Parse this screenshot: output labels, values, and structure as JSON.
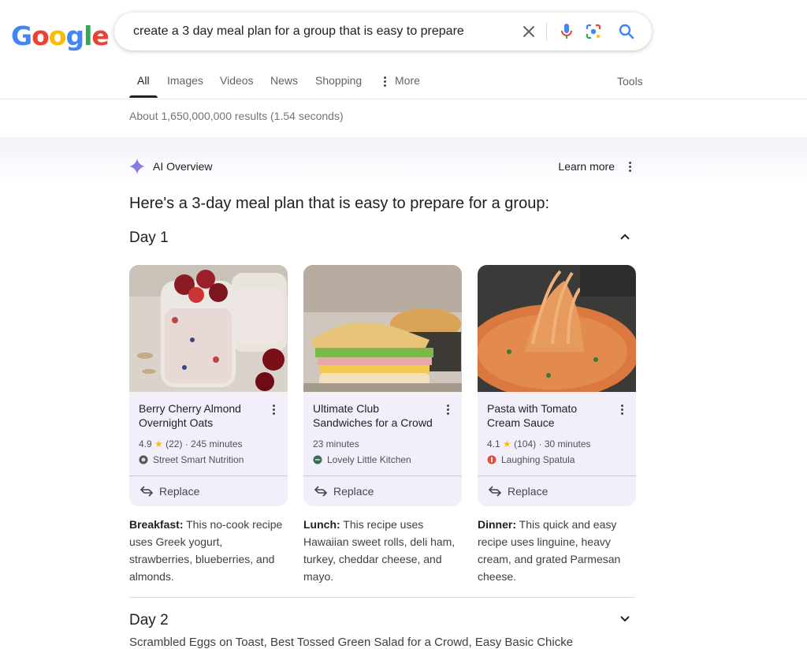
{
  "logo": {
    "letters": [
      "G",
      "o",
      "o",
      "g",
      "l",
      "e"
    ],
    "colors": [
      "#4285F4",
      "#EA4335",
      "#FBBC05",
      "#4285F4",
      "#34A853",
      "#EA4335"
    ]
  },
  "search": {
    "query": "create a 3 day meal plan for a group that is easy to prepare"
  },
  "tabs": {
    "items": [
      "All",
      "Images",
      "Videos",
      "News",
      "Shopping",
      "More"
    ],
    "tools": "Tools",
    "active": "All"
  },
  "stats": "About 1,650,000,000 results (1.54 seconds)",
  "ai": {
    "title": "AI Overview",
    "learn_more": "Learn more",
    "headline": "Here's a 3-day meal plan that is easy to prepare for a group:"
  },
  "day1": {
    "label": "Day 1"
  },
  "cards": [
    {
      "title": "Berry Cherry Almond Overnight Oats",
      "rating": "4.9",
      "reviews": "(22)",
      "time": "245 minutes",
      "source": "Street Smart Nutrition",
      "replace": "Replace"
    },
    {
      "title": "Ultimate Club Sandwiches for a Crowd",
      "time": "23 minutes",
      "source": "Lovely Little Kitchen",
      "replace": "Replace"
    },
    {
      "title": "Pasta with Tomato Cream Sauce",
      "rating": "4.1",
      "reviews": "(104)",
      "time": "30 minutes",
      "source": "Laughing Spatula",
      "replace": "Replace"
    }
  ],
  "meals": [
    {
      "label": "Breakfast:",
      "text": " This no-cook recipe uses Greek yogurt, strawberries, blueberries, and almonds."
    },
    {
      "label": "Lunch:",
      "text": " This recipe uses Hawaiian sweet rolls, deli ham, turkey, cheddar cheese, and mayo."
    },
    {
      "label": "Dinner:",
      "text": " This quick and easy recipe uses linguine, heavy cream, and grated Parmesan cheese."
    }
  ],
  "day2": {
    "label": "Day 2",
    "summary": "Scrambled Eggs on Toast, Best Tossed Green Salad for a Crowd, Easy Basic Chicke"
  },
  "colors": {
    "accent": "#1a73e8",
    "card_bg": "#f3effa",
    "star": "#fbbc04"
  }
}
